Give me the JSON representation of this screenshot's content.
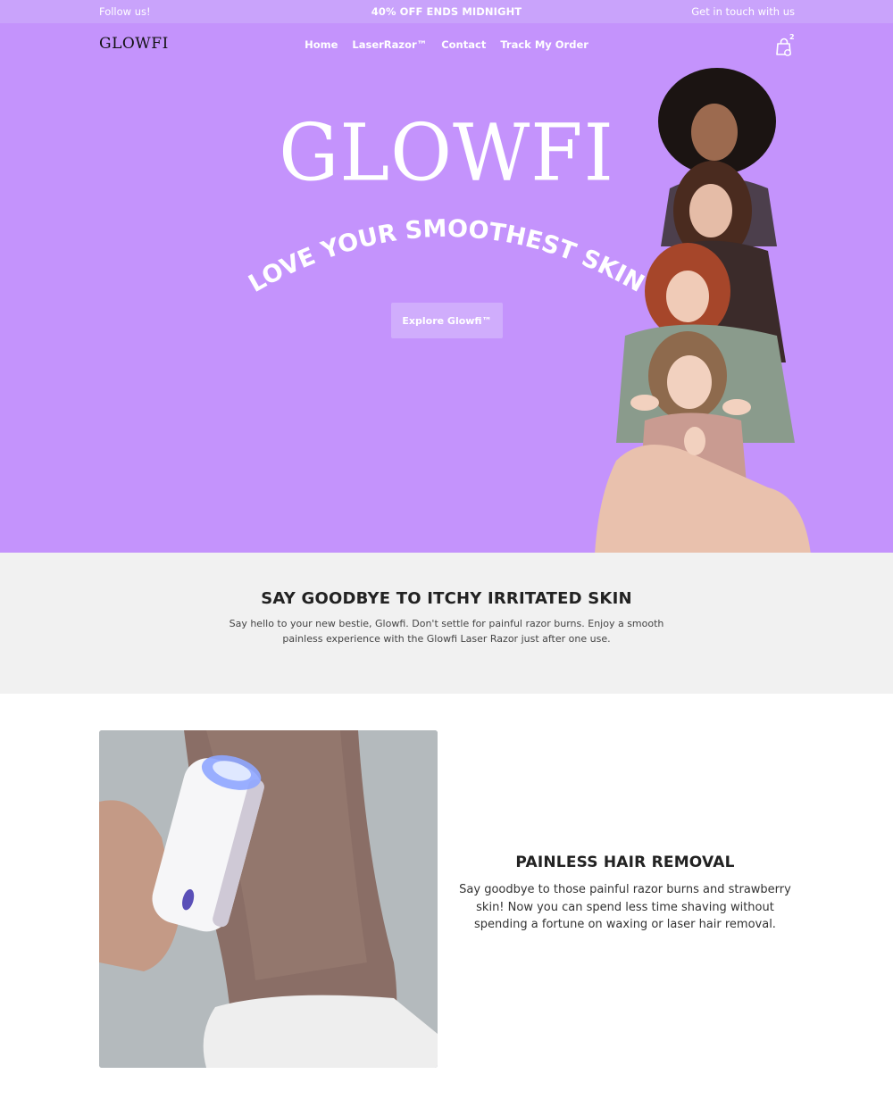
{
  "announcement": {
    "left": "Follow us!",
    "center": "40% OFF ENDS MIDNIGHT",
    "right": "Get in touch with us"
  },
  "header": {
    "logo": "GLOWFI",
    "nav": [
      "Home",
      "LaserRazor™",
      "Contact",
      "Track My Order"
    ],
    "cart_count": "2",
    "cart_icon": "shopping-bag-icon"
  },
  "hero": {
    "title": "GLOWFI",
    "tagline": "LOVE YOUR SMOOTHEST SKIN",
    "cta_label": "Explore Glowfi™",
    "background": "#c493fc"
  },
  "intro": {
    "heading": "SAY GOODBYE TO ITCHY IRRITATED SKIN",
    "body": "Say hello to your new bestie, Glowfi. Don't settle for painful razor burns. Enjoy a smooth painless experience with the Glowfi Laser Razor just after one use."
  },
  "feature": {
    "heading": "PAINLESS HAIR REMOVAL",
    "body": "Say goodbye to those painful razor burns and strawberry skin! Now you can spend less time shaving without spending a fortune on waxing or laser hair removal."
  },
  "colors": {
    "announcement_bg": "#c9a3fb",
    "hero_bg": "#c493fc",
    "intro_bg": "#f1f1f1"
  }
}
